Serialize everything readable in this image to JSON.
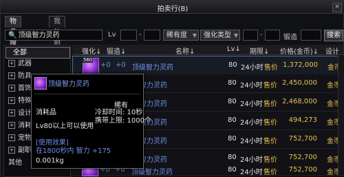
{
  "window": {
    "title": "拍卖行(B)",
    "close_label": "×"
  },
  "tabs": [
    {
      "label": "物品搜索",
      "active": true
    },
    {
      "label": "我的拍卖品",
      "active": false
    }
  ],
  "search": {
    "name_value": "顶级智力灵药",
    "level_label": "Lv",
    "level_min": "",
    "level_max": "",
    "rarity_label": "稀有度",
    "upgrade_type_label": "强化类型",
    "upgrade_from": "",
    "upgrade_to": "",
    "forge_label": "锻造",
    "forge_value": "",
    "search_button": "搜索"
  },
  "sidebar": {
    "items": [
      {
        "label": "全部",
        "expandable": false,
        "active": true
      },
      {
        "label": "武器",
        "expandable": true
      },
      {
        "label": "防具",
        "expandable": true
      },
      {
        "label": "首饰",
        "expandable": true
      },
      {
        "label": "特殊",
        "expandable": true
      },
      {
        "label": "设计",
        "expandable": true
      },
      {
        "label": "消耗",
        "expandable": true
      },
      {
        "label": "宠物",
        "expandable": true
      },
      {
        "label": "副职",
        "expandable": true
      },
      {
        "label": "其他",
        "expandable": false
      }
    ]
  },
  "columns": {
    "upgrade": "强化↓",
    "forge": "锻造↓",
    "name": "名称↓",
    "level": "Lv↓",
    "time": "期限↓",
    "price": "价格(金币)↓",
    "unit": "设计"
  },
  "rows": [
    {
      "badge": "560",
      "upgrade": "+0",
      "forge": "+0",
      "name": "顶级智力灵药",
      "level": "80",
      "time": "24小时",
      "price_label": "售价",
      "price": "1,372,000",
      "seller": "金币",
      "selected": true
    },
    {
      "upgrade": "",
      "forge": "",
      "name": "智力灵药",
      "level": "80",
      "time": "24小时",
      "price_label": "售价",
      "price": "2,450,000",
      "seller": "金币"
    },
    {
      "upgrade": "",
      "forge": "",
      "name": "智力灵药",
      "level": "80",
      "time": "24小时",
      "price_label": "售价",
      "price": "2,468,000",
      "seller": "金币"
    },
    {
      "upgrade": "",
      "forge": "",
      "name": "智力灵药",
      "level": "80",
      "time": "24小时",
      "price_label": "售价",
      "price": "494,273",
      "seller": "金币"
    },
    {
      "upgrade": "",
      "forge": "",
      "name": "智力灵药",
      "level": "80",
      "time": "24小时",
      "price_label": "售价",
      "price": "752,700",
      "seller": "金币"
    },
    {
      "upgrade": "",
      "forge": "",
      "name": "智力灵药",
      "level": "80",
      "time": "24小时",
      "price_label": "售价",
      "price": "752,700",
      "seller": "金币"
    },
    {
      "upgrade": "+0",
      "forge": "+0",
      "name": "顶级智力灵药",
      "level": "80",
      "time": "24小时",
      "price_label": "售价",
      "price": "752,700",
      "seller": "金币"
    }
  ],
  "tooltip": {
    "title": "顶级智力灵药",
    "category": "消耗品",
    "rarity": "稀有",
    "cooldown": "冷却时间: 10秒",
    "carry_limit": "携带上限: 1000个",
    "level_req": "Lv80以上可以使用",
    "effect_header": "[使用效果]",
    "effect_line": "在1800秒内 智力 +175",
    "weight": "0.001kg"
  },
  "colors": {
    "rare_blue": "#6d8fe8",
    "gold": "#e8c052",
    "bg": "#101114"
  }
}
